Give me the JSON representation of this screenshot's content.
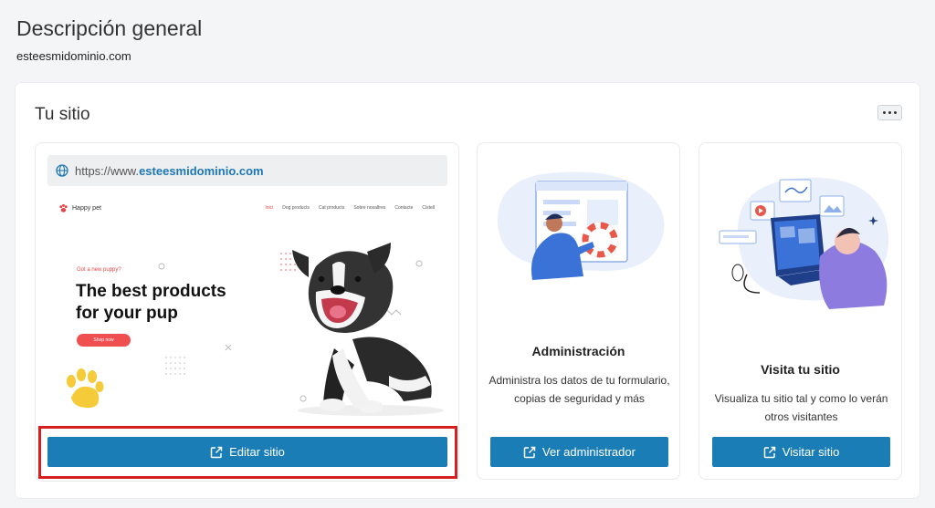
{
  "page": {
    "title": "Descripción general",
    "domain": "esteesmidominio.com"
  },
  "panel": {
    "title": "Tu sitio"
  },
  "site_card": {
    "url_prefix": "https://www.",
    "url_domain": "esteesmidominio.com",
    "button_label": "Editar sitio",
    "preview": {
      "brand": "Happy pet",
      "nav": [
        "Inici",
        "Dog products",
        "Cat products",
        "Sobre nosaltres",
        "Contacte",
        "Cistell"
      ],
      "tagline": "Got a new puppy?",
      "headline_1": "The best products",
      "headline_2": "for your pup",
      "cta": "Shop now"
    }
  },
  "admin_card": {
    "title": "Administración",
    "description": "Administra los datos de tu formulario, copias de seguridad y más",
    "button_label": "Ver administrador"
  },
  "visit_card": {
    "title": "Visita tu sitio",
    "description": "Visualiza tu sitio tal y como lo verán otros visitantes",
    "button_label": "Visitar sitio"
  },
  "colors": {
    "accent": "#1a7db6",
    "highlight": "#d61f1f",
    "brand_red": "#ef4f4f"
  }
}
